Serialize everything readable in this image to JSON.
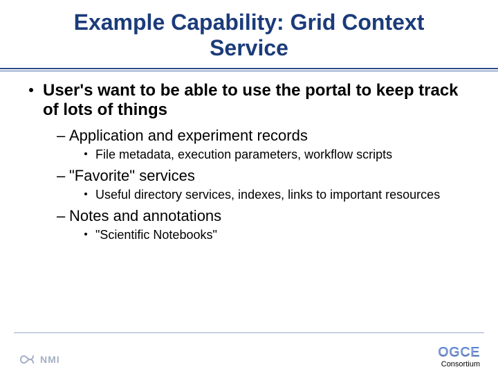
{
  "title": "Example Capability: Grid Context Service",
  "lead": "User's want to be able to use the portal to keep track of lots of things",
  "items": [
    {
      "label": "Application and experiment records",
      "detail": "File metadata, execution parameters, workflow scripts"
    },
    {
      "label": "\"Favorite\" services",
      "detail": "Useful directory services, indexes, links to important resources"
    },
    {
      "label": "Notes and annotations",
      "detail": "\"Scientific Notebooks\""
    }
  ],
  "footer": {
    "left_logo_text": "NMI",
    "right_logo_text": "OGCE",
    "right_sub": "Consortium"
  }
}
